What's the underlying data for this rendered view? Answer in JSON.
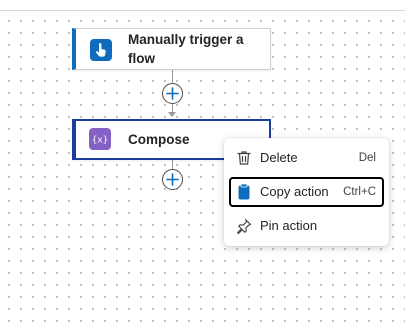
{
  "canvas": {
    "trigger_card": {
      "title": "Manually trigger a flow",
      "icon": "touch-hand-icon",
      "accent_color": "#0f6cbd"
    },
    "compose_card": {
      "title": "Compose",
      "icon": "compose-braces-icon",
      "accent_color": "#8661c5",
      "selected_border_color": "#1c3d9e"
    },
    "add_buttons": [
      "plus-icon",
      "plus-icon"
    ]
  },
  "context_menu": {
    "items": [
      {
        "label": "Delete",
        "shortcut": "Del",
        "icon": "trash-icon"
      },
      {
        "label": "Copy action",
        "shortcut": "Ctrl+C",
        "icon": "clipboard-icon",
        "focused": true
      },
      {
        "label": "Pin action",
        "shortcut": "",
        "icon": "pin-icon"
      }
    ]
  }
}
